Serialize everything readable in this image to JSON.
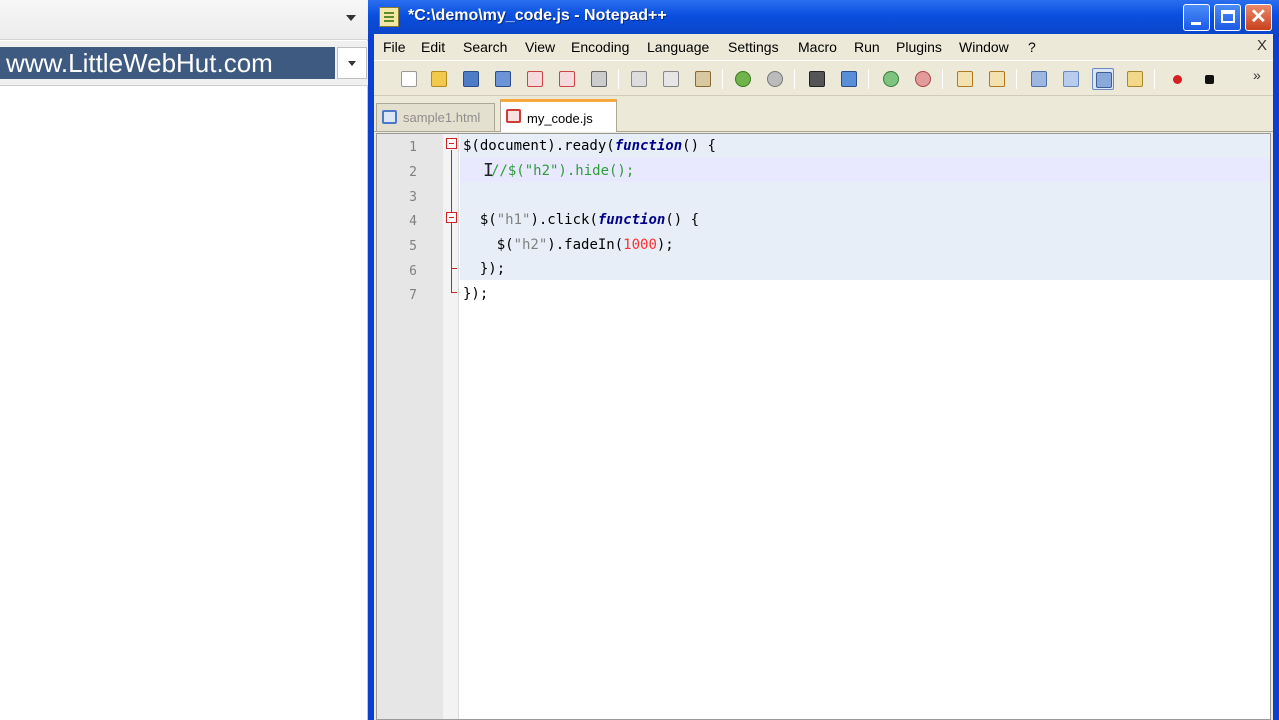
{
  "browser": {
    "address": "www.LittleWebHut.com"
  },
  "window": {
    "title": "*C:\\demo\\my_code.js - Notepad++",
    "close_glyph": "✕"
  },
  "menu": {
    "items": [
      "File",
      "Edit",
      "Search",
      "View",
      "Encoding",
      "Language",
      "Settings",
      "Macro",
      "Run",
      "Plugins",
      "Window",
      "?"
    ],
    "close_glyph": "X"
  },
  "toolbar": {
    "overflow_glyph": "»",
    "icons": [
      "new-file-icon",
      "open-file-icon",
      "save-icon",
      "save-all-icon",
      "close-file-icon",
      "close-all-icon",
      "print-icon",
      "cut-icon",
      "copy-icon",
      "paste-icon",
      "undo-icon",
      "redo-icon",
      "find-icon",
      "replace-icon",
      "zoom-in-icon",
      "zoom-out-icon",
      "sync-vertical-icon",
      "sync-horizontal-icon",
      "word-wrap-icon",
      "show-all-chars-icon",
      "indent-guide-icon",
      "user-lang-icon",
      "record-macro-icon",
      "stop-macro-icon"
    ]
  },
  "tabs": [
    {
      "label": "sample1.html",
      "active": false
    },
    {
      "label": "my_code.js",
      "active": true
    }
  ],
  "editor": {
    "line_numbers": [
      "1",
      "2",
      "3",
      "4",
      "5",
      "6",
      "7"
    ],
    "current_line": 2,
    "colors": {
      "keyword": "#00008b",
      "string": "#808080",
      "number": "#ff3030",
      "comment": "#2f9c3a",
      "fold_marker": "#cc2222"
    },
    "lines": [
      {
        "t1": "$(document).ready(",
        "kw": "function",
        "t2": "() {"
      },
      {
        "cmt": "//$(\"h2\").hide();"
      },
      {},
      {
        "t1": "  $(",
        "s": "\"h1\"",
        "t2": ").click(",
        "kw": "function",
        "t3": "() {"
      },
      {
        "t1": "    $(",
        "s": "\"h2\"",
        "t2": ").fadeIn(",
        "n": "1000",
        "t3": ");"
      },
      {
        "t1": "  });"
      },
      {
        "t1": "});"
      }
    ]
  }
}
